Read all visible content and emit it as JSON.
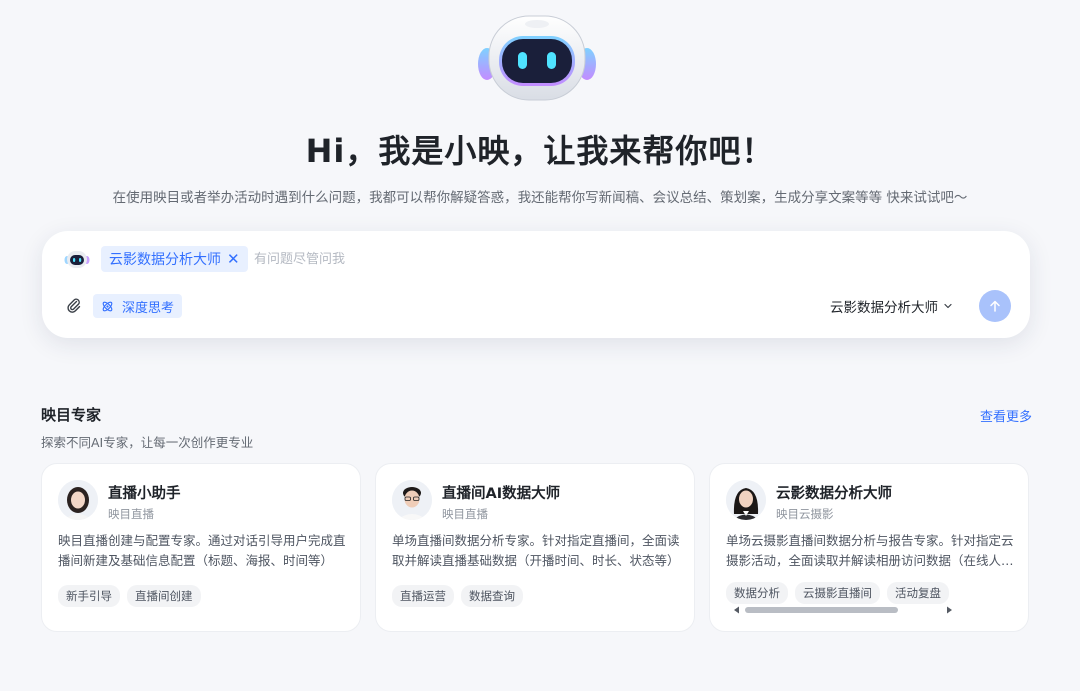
{
  "hero": {
    "title": "Hi，我是小映，让我来帮你吧！",
    "subtitle": "在使用映目或者举办活动时遇到什么问题，我都可以帮你解疑答惑，我还能帮你写新闻稿、会议总结、策划案，生成分享文案等等 快来试试吧～"
  },
  "chat": {
    "agent_chip": "云影数据分析大师",
    "placeholder": "有问题尽管问我",
    "deep_think_label": "深度思考",
    "model_select": "云影数据分析大师",
    "icons": {
      "attach": "paperclip-icon",
      "deep_think": "atom-icon",
      "send": "arrow-up-icon",
      "close": "close-icon",
      "dropdown": "chevron-down-icon"
    }
  },
  "experts": {
    "title": "映目专家",
    "subtitle": "探索不同AI专家，让每一次创作更专业",
    "see_more": "查看更多",
    "cards": [
      {
        "name": "直播小助手",
        "org": "映目直播",
        "desc": "映目直播创建与配置专家。通过对话引导用户完成直播间新建及基础信息配置（标题、海报、时间等）",
        "tags": [
          "新手引导",
          "直播间创建"
        ]
      },
      {
        "name": "直播间AI数据大师",
        "org": "映目直播",
        "desc": "单场直播间数据分析专家。针对指定直播间，全面读取并解读直播基础数据（开播时间、时长、状态等）",
        "tags": [
          "直播运营",
          "数据查询"
        ]
      },
      {
        "name": "云影数据分析大师",
        "org": "映目云摄影",
        "desc": "单场云摄影直播间数据分析与报告专家。针对指定云摄影活动，全面读取并解读相册访问数据（在线人数等）",
        "tags": [
          "数据分析",
          "云摄影直播间",
          "活动复盘"
        ]
      }
    ]
  },
  "colors": {
    "accent": "#3370ff",
    "chip_bg": "#e8f0ff",
    "send_bg": "#a9c2fb",
    "page_bg": "#f6f7fa"
  }
}
